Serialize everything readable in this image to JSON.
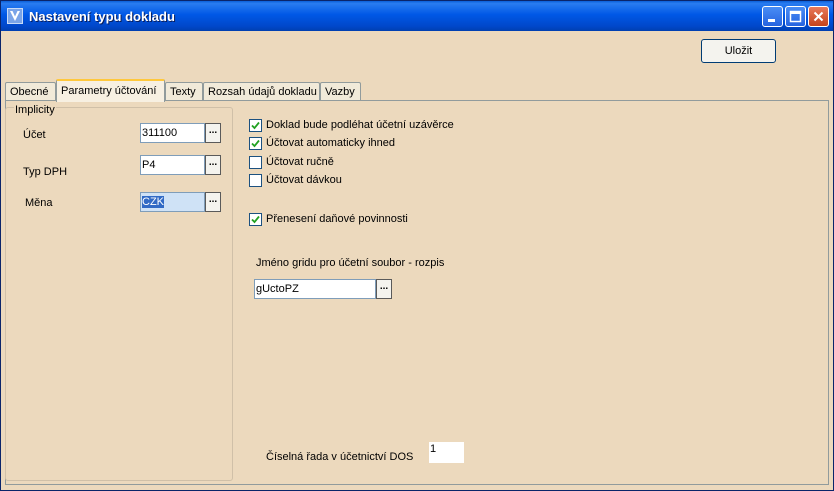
{
  "window": {
    "title": "Nastavení typu dokladu",
    "icon": "app-icon"
  },
  "titlebar_buttons": [
    "minimize-icon",
    "maximize-icon",
    "close-icon"
  ],
  "toolbar": {
    "save_label": "Uložit"
  },
  "tabs": [
    {
      "label": "Obecné",
      "active": false
    },
    {
      "label": "Parametry účtování",
      "active": true
    },
    {
      "label": "Texty",
      "active": false
    },
    {
      "label": "Rozsah údajů dokladu",
      "active": false
    },
    {
      "label": "Vazby",
      "active": false
    }
  ],
  "implicity": {
    "title": "Implicity",
    "ucet": {
      "label": "Účet",
      "value": "311100"
    },
    "typ_dph": {
      "label": "Typ DPH",
      "value": "P4"
    },
    "mena": {
      "label": "Měna",
      "value": "CZK"
    },
    "ellipsis": "..."
  },
  "options": {
    "podlehat": {
      "label": "Doklad bude podléhat účetní uzávěrce",
      "checked": true
    },
    "automaticky": {
      "label": "Účtovat automaticky ihned",
      "checked": true
    },
    "rucne": {
      "label": "Účtovat ručně",
      "checked": false
    },
    "davkou": {
      "label": "Účtovat dávkou",
      "checked": false
    },
    "preneseni": {
      "label": "Přenesení daňové povinnosti",
      "checked": true
    }
  },
  "grid": {
    "label": "Jméno gridu pro účetní soubor - rozpis",
    "value": "gUctoPZ"
  },
  "dos": {
    "label": "Číselná řada v účetnictví DOS",
    "value": "1"
  },
  "colors": {
    "titlebar": "#0054e3",
    "background": "#ecd9bd",
    "tab_highlight": "#ffc83c"
  }
}
